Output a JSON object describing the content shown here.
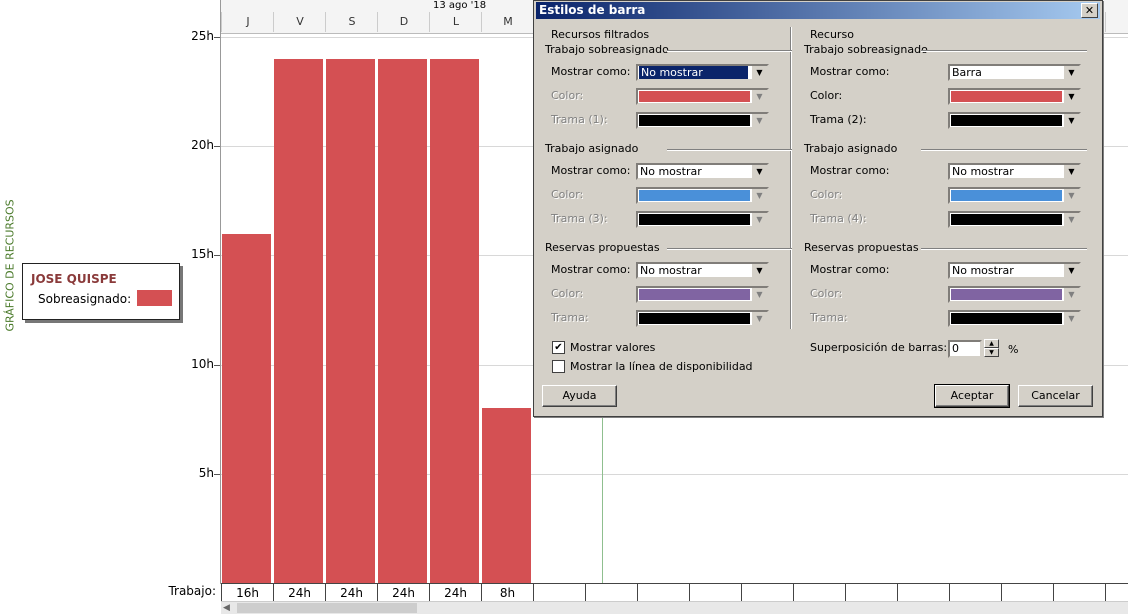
{
  "side_label": "GRÁFICO DE RECURSOS",
  "legend": {
    "name": "JOSE QUISPE",
    "label": "Sobreasignado:",
    "color": "#d45053"
  },
  "timescale": {
    "week_label": "13 ago '18",
    "days": [
      "J",
      "V",
      "S",
      "D",
      "L",
      "M"
    ]
  },
  "chart_data": {
    "type": "bar",
    "categories": [
      "J",
      "V",
      "S",
      "D",
      "L",
      "M"
    ],
    "values": [
      16,
      24,
      24,
      24,
      24,
      8
    ],
    "ylim": [
      0,
      25
    ],
    "yticks": [
      "25h",
      "20h",
      "15h",
      "10h",
      "5h"
    ],
    "row_label": "Trabajo:",
    "row_values": [
      "16h",
      "24h",
      "24h",
      "24h",
      "24h",
      "8h"
    ],
    "color": "#d45053"
  },
  "dialog": {
    "title": "Estilos de barra",
    "left": {
      "heading": "Recursos filtrados",
      "sections": [
        {
          "title": "Trabajo sobreasignado",
          "show_label": "Mostrar como:",
          "show_value": "No mostrar",
          "color_label": "Color:",
          "color": "#d45053",
          "pattern_label": "Trama (1):"
        },
        {
          "title": "Trabajo asignado",
          "show_label": "Mostrar como:",
          "show_value": "No mostrar",
          "color_label": "Color:",
          "color": "#4a90d9",
          "pattern_label": "Trama (3):"
        },
        {
          "title": "Reservas propuestas",
          "show_label": "Mostrar como:",
          "show_value": "No mostrar",
          "color_label": "Color:",
          "color": "#8064a2",
          "pattern_label": "Trama:"
        }
      ]
    },
    "right": {
      "heading": "Recurso",
      "sections": [
        {
          "title": "Trabajo sobreasignado",
          "show_label": "Mostrar como:",
          "show_value": "Barra",
          "color_label": "Color:",
          "color": "#d45053",
          "pattern_label": "Trama (2):"
        },
        {
          "title": "Trabajo asignado",
          "show_label": "Mostrar como:",
          "show_value": "No mostrar",
          "color_label": "Color:",
          "color": "#4a90d9",
          "pattern_label": "Trama (4):"
        },
        {
          "title": "Reservas propuestas",
          "show_label": "Mostrar como:",
          "show_value": "No mostrar",
          "color_label": "Color:",
          "color": "#8064a2",
          "pattern_label": "Trama:"
        }
      ]
    },
    "show_values_label": "Mostrar valores",
    "show_values_checked": true,
    "availability_label": "Mostrar la línea de disponibilidad",
    "availability_checked": false,
    "overlap_label": "Superposición de barras:",
    "overlap_value": "0",
    "overlap_unit": "%",
    "help_button": "Ayuda",
    "ok_button": "Aceptar",
    "cancel_button": "Cancelar",
    "close_glyph": "✕"
  }
}
